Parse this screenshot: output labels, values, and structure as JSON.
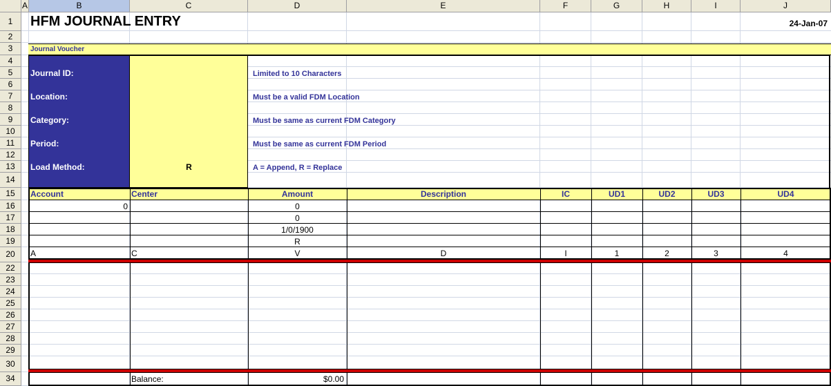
{
  "columns": [
    "A",
    "B",
    "C",
    "D",
    "E",
    "F",
    "G",
    "H",
    "I",
    "J"
  ],
  "rows": [
    "1",
    "2",
    "3",
    "4",
    "5",
    "6",
    "7",
    "8",
    "9",
    "10",
    "11",
    "12",
    "13",
    "14",
    "15",
    "16",
    "17",
    "18",
    "19",
    "20",
    "22",
    "23",
    "24",
    "25",
    "26",
    "27",
    "28",
    "29",
    "30",
    "34"
  ],
  "title": "HFM JOURNAL ENTRY",
  "date": "24-Jan-07",
  "section_label": "Journal Voucher",
  "fields": [
    {
      "label": "Journal ID:",
      "value": "",
      "note": "Limited to 10 Characters"
    },
    {
      "label": "Location:",
      "value": "",
      "note": "Must be a valid FDM Location"
    },
    {
      "label": "Category:",
      "value": "",
      "note": "Must be same as current FDM Category"
    },
    {
      "label": "Period:",
      "value": "",
      "note": "Must be same as current FDM Period"
    },
    {
      "label": "Load Method:",
      "value": "R",
      "note": "A = Append, R = Replace"
    }
  ],
  "table_headers": [
    "Account",
    "Center",
    "Amount",
    "Description",
    "IC",
    "UD1",
    "UD2",
    "UD3",
    "UD4"
  ],
  "row16": {
    "b": "0",
    "d": "0"
  },
  "row17": {
    "d": "0"
  },
  "row18": {
    "d": "1/0/1900"
  },
  "row19": {
    "d": "R"
  },
  "row20": [
    "A",
    "C",
    "V",
    "D",
    "I",
    "1",
    "2",
    "3",
    "4"
  ],
  "balance_label": "Balance:",
  "balance_value": "$0.00",
  "colors": {
    "navy": "#333399",
    "yellow": "#ffff99",
    "red": "#cc0000",
    "header_bg": "#ece9d8"
  }
}
